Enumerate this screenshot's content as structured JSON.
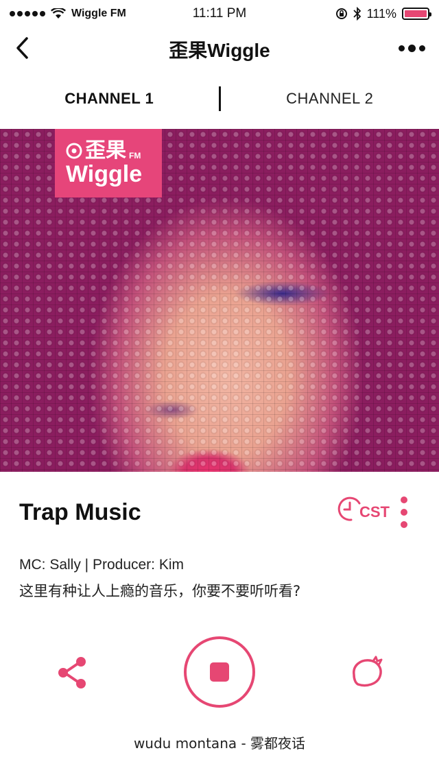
{
  "status_bar": {
    "carrier": "Wiggle FM",
    "time": "11:11 PM",
    "battery": "111%"
  },
  "nav": {
    "title": "歪果Wiggle"
  },
  "tabs": [
    {
      "label": "CHANNEL 1",
      "active": true
    },
    {
      "label": "CHANNEL 2",
      "active": false
    }
  ],
  "cover": {
    "logo_cn": "歪果",
    "logo_fm": "FM",
    "logo_en": "Wiggle"
  },
  "show": {
    "title": "Trap Music",
    "timezone_label": "CST",
    "credits": "MC: Sally | Producer: Kim",
    "description": "这里有种让人上瘾的音乐，你要不要听听看?"
  },
  "player": {
    "now_playing": "wudu montana - 雾都夜话"
  },
  "colors": {
    "accent": "#e64773",
    "text": "#111111"
  },
  "icons": [
    "back-icon",
    "more-icon",
    "cst-clock-icon",
    "kebab-icon",
    "share-icon",
    "stop-icon",
    "strawberry-icon",
    "wifi-icon",
    "bluetooth-icon",
    "battery-icon"
  ]
}
